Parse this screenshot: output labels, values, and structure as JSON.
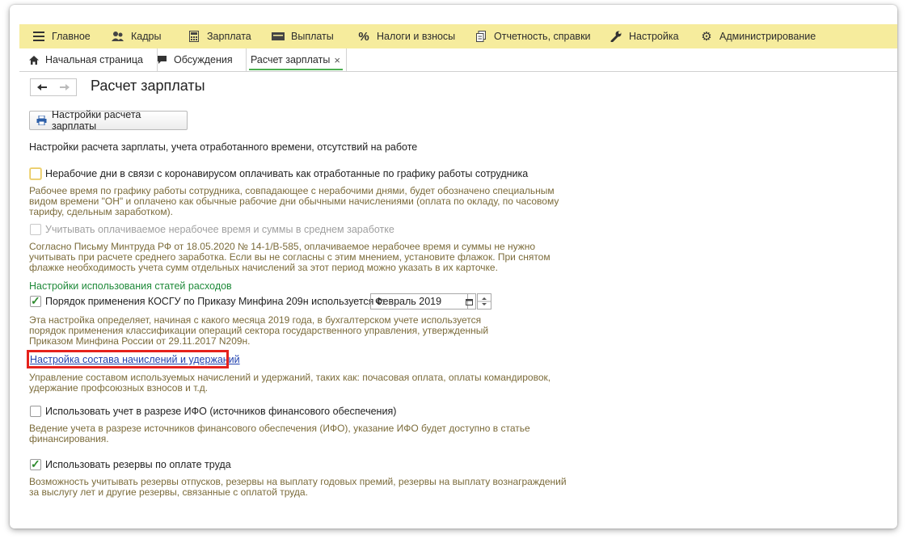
{
  "menu": {
    "items": [
      {
        "label": "Главное",
        "icon": "hamburger-icon"
      },
      {
        "label": "Кадры",
        "icon": "people-icon"
      },
      {
        "label": "Зарплата",
        "icon": "calculator-icon"
      },
      {
        "label": "Выплаты",
        "icon": "cash-icon"
      },
      {
        "label": "Налоги и взносы",
        "icon": "percent-icon"
      },
      {
        "label": "Отчетность, справки",
        "icon": "documents-icon"
      },
      {
        "label": "Настройка",
        "icon": "wrench-icon"
      },
      {
        "label": "Администрирование",
        "icon": "gear-icon"
      }
    ]
  },
  "tabs": [
    {
      "label": "Начальная страница",
      "icon": "home-icon"
    },
    {
      "label": "Обсуждения",
      "icon": "chat-icon"
    },
    {
      "label": "Расчет зарплаты",
      "close": "×"
    }
  ],
  "page": {
    "title": "Расчет зарплаты",
    "settings_button": "Настройки расчета зарплаты",
    "section_header": "Настройки расчета зарплаты, учета отработанного времени, отсутствий на работе",
    "option1": {
      "label": "Нерабочие дни в связи с коронавирусом оплачивать как отработанные по графику работы сотрудника",
      "checked": false,
      "desc1": "Рабочее время по графику работы сотрудника, совпадающее с нерабочими днями, будет обозначено специальным",
      "desc2": "видом времени \"ОН\" и оплачено как обычные рабочие дни обычными начислениями (оплата по окладу, по часовому",
      "desc3": "тарифу, сдельным заработком)."
    },
    "option2": {
      "label": "Учитывать оплачиваемое нерабочее время и суммы в среднем заработке",
      "checked": false,
      "disabled": true,
      "desc1": "Согласно Письму Минтруда РФ от 18.05.2020 № 14-1/В-585, оплачиваемое нерабочее время и суммы не нужно",
      "desc2": "учитывать при расчете среднего заработка. Если вы не согласны с этим мнением, установите флажок. При снятом",
      "desc3": "флажке необходимость учета сумм отдельных начислений за этот период можно указать в их карточке."
    },
    "expenses_header": "Настройки использования статей расходов",
    "option3": {
      "label": "Порядок применения КОСГУ по Приказу Минфина 209н используется с:",
      "checked": true,
      "date_value": "Февраль 2019",
      "desc1": "Эта настройка определяет, начиная с какого месяца 2019 года, в бухгалтерском учете используется",
      "desc2": "порядок применения классификации операций сектора государственного управления, утвержденный",
      "desc3": "Приказом Минфина России от 29.11.2017 N209н."
    },
    "link": "Настройка состава начислений и удержаний",
    "link_desc1": "Управление составом используемых начислений и удержаний, таких как: почасовая оплата, оплаты командировок,",
    "link_desc2": "удержание профсоюзных взносов и т.д.",
    "option4": {
      "label": "Использовать учет в разрезе ИФО (источников финансового обеспечения)",
      "checked": false,
      "desc1": "Ведение учета в разрезе источников финансового обеспечения (ИФО), указание ИФО будет доступно в статье",
      "desc2": "финансирования."
    },
    "option5": {
      "label": "Использовать резервы по оплате труда",
      "checked": true,
      "desc1": "Возможность учитывать резервы отпусков,  резервы на выплату годовых премий, резервы на выплату вознаграждений",
      "desc2": "за выслугу лет и другие резервы, связанные с оплатой труда."
    }
  },
  "colors": {
    "menubar": "#f6ec9d",
    "description": "#7b6b3a",
    "section_green": "#1f8a3a",
    "link": "#2142b0",
    "highlight_red": "#e5221c"
  }
}
